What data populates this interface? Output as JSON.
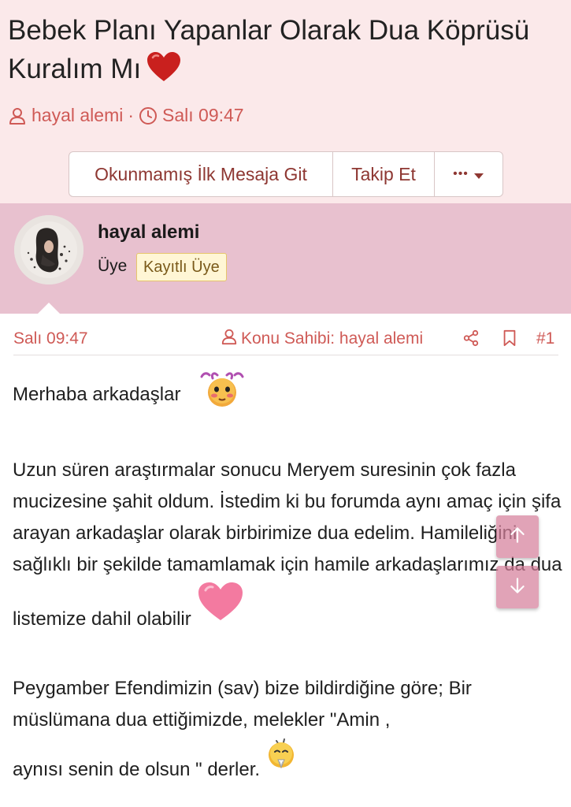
{
  "thread": {
    "title": "Bebek Planı Yapanlar Olarak Dua Köprüsü Kuralım Mı",
    "author": "hayal alemi",
    "separator": "·",
    "time": "Salı 09:47"
  },
  "actions": {
    "unread_label": "Okunmamış İlk Mesaja Git",
    "follow_label": "Takip Et",
    "more_label": "•••"
  },
  "post": {
    "username": "hayal alemi",
    "role": "Üye",
    "badge": "Kayıtlı Üye",
    "date": "Salı 09:47",
    "owner_label": "Konu Sahibi: hayal alemi",
    "number": "#1",
    "greeting": "Merhaba arkadaşlar",
    "paragraph1": "Uzun süren araştırmalar sonucu Meryem suresinin çok fazla mucizesine şahit oldum. İstedim ki bu forumda aynı amaç için şifa arayan arkadaşlar olarak birbirimize dua edelim. Hamileliğini sağlıklı bir şekilde tamamlamak için hamile arkadaşlarımız da dua",
    "paragraph1_end": "listemize dahil olabilir",
    "paragraph2": "Peygamber Efendimizin (sav) bize bildirdiğine göre; Bir müslümana dua ettiğimizde, melekler \"Amin ,",
    "paragraph2_end": "aynısı senin de olsun \" derler."
  },
  "icons": {
    "author": "user-icon",
    "time": "clock-icon",
    "share": "share-icon",
    "bookmark": "bookmark-icon",
    "scroll_up": "arrow-up-icon",
    "scroll_down": "arrow-down-icon"
  },
  "colors": {
    "header_bg": "#fbe9ea",
    "user_band_bg": "#e8c1cf",
    "accent": "#cf5a56",
    "button_text": "#8e3732"
  }
}
